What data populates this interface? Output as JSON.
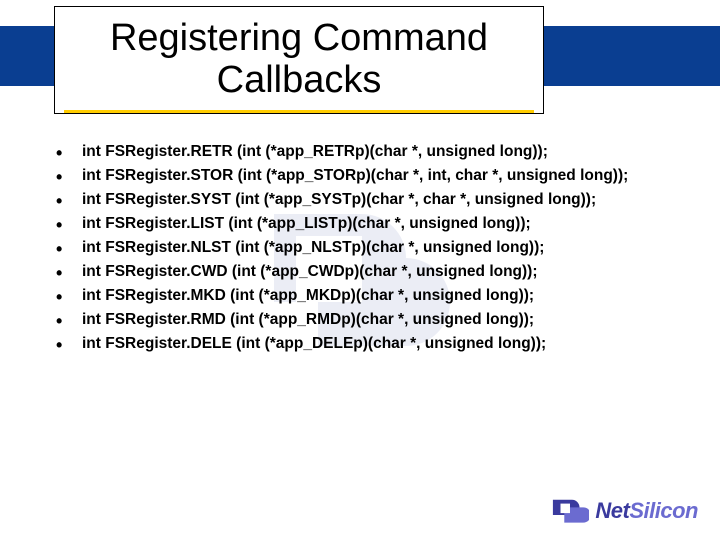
{
  "title": "Registering Command Callbacks",
  "bullets": [
    "int FSRegister.RETR (int (*app_RETRp)(char *, unsigned long));",
    "int FSRegister.STOR (int (*app_STORp)(char *, int, char *, unsigned long));",
    "int FSRegister.SYST (int (*app_SYSTp)(char *, char *, unsigned long));",
    "int FSRegister.LIST (int (*app_LISTp)(char *, unsigned long));",
    "int FSRegister.NLST (int (*app_NLSTp)(char *, unsigned long));",
    "int FSRegister.CWD (int (*app_CWDp)(char *, unsigned long));",
    "int FSRegister.MKD (int (*app_MKDp)(char *, unsigned long));",
    "int FSRegister.RMD (int (*app_RMDp)(char *, unsigned long));",
    "int FSRegister.DELE (int (*app_DELEp)(char *, unsigned long));"
  ],
  "logo": {
    "brand_a": "Net",
    "brand_b": "Silicon"
  },
  "colors": {
    "band": "#0a3e91",
    "underline": "#ffcc00",
    "logo_primary": "#3a3a9e"
  }
}
